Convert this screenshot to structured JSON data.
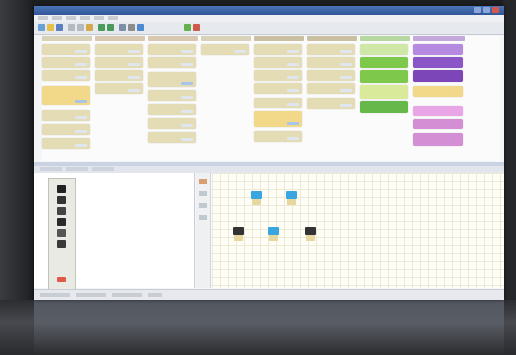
{
  "colors": {
    "titlebar": "#3a64a8",
    "card_tan": "#e3dcb4",
    "card_yellow": "#f2d98a",
    "card_green": "#7ec84c",
    "card_purple": "#8a55c6",
    "card_pink": "#d48fd4",
    "node_blue": "#3aa6e0",
    "node_dark": "#333333"
  },
  "icons": [
    "app-icon",
    "new-icon",
    "open-icon",
    "save-icon",
    "cut-icon",
    "copy-icon",
    "paste-icon",
    "undo-icon",
    "redo-icon",
    "zoom-icon"
  ],
  "palette_icons": [
    "pointer-icon",
    "task-icon",
    "gateway-icon",
    "event-icon",
    "connector-icon",
    "note-icon"
  ]
}
